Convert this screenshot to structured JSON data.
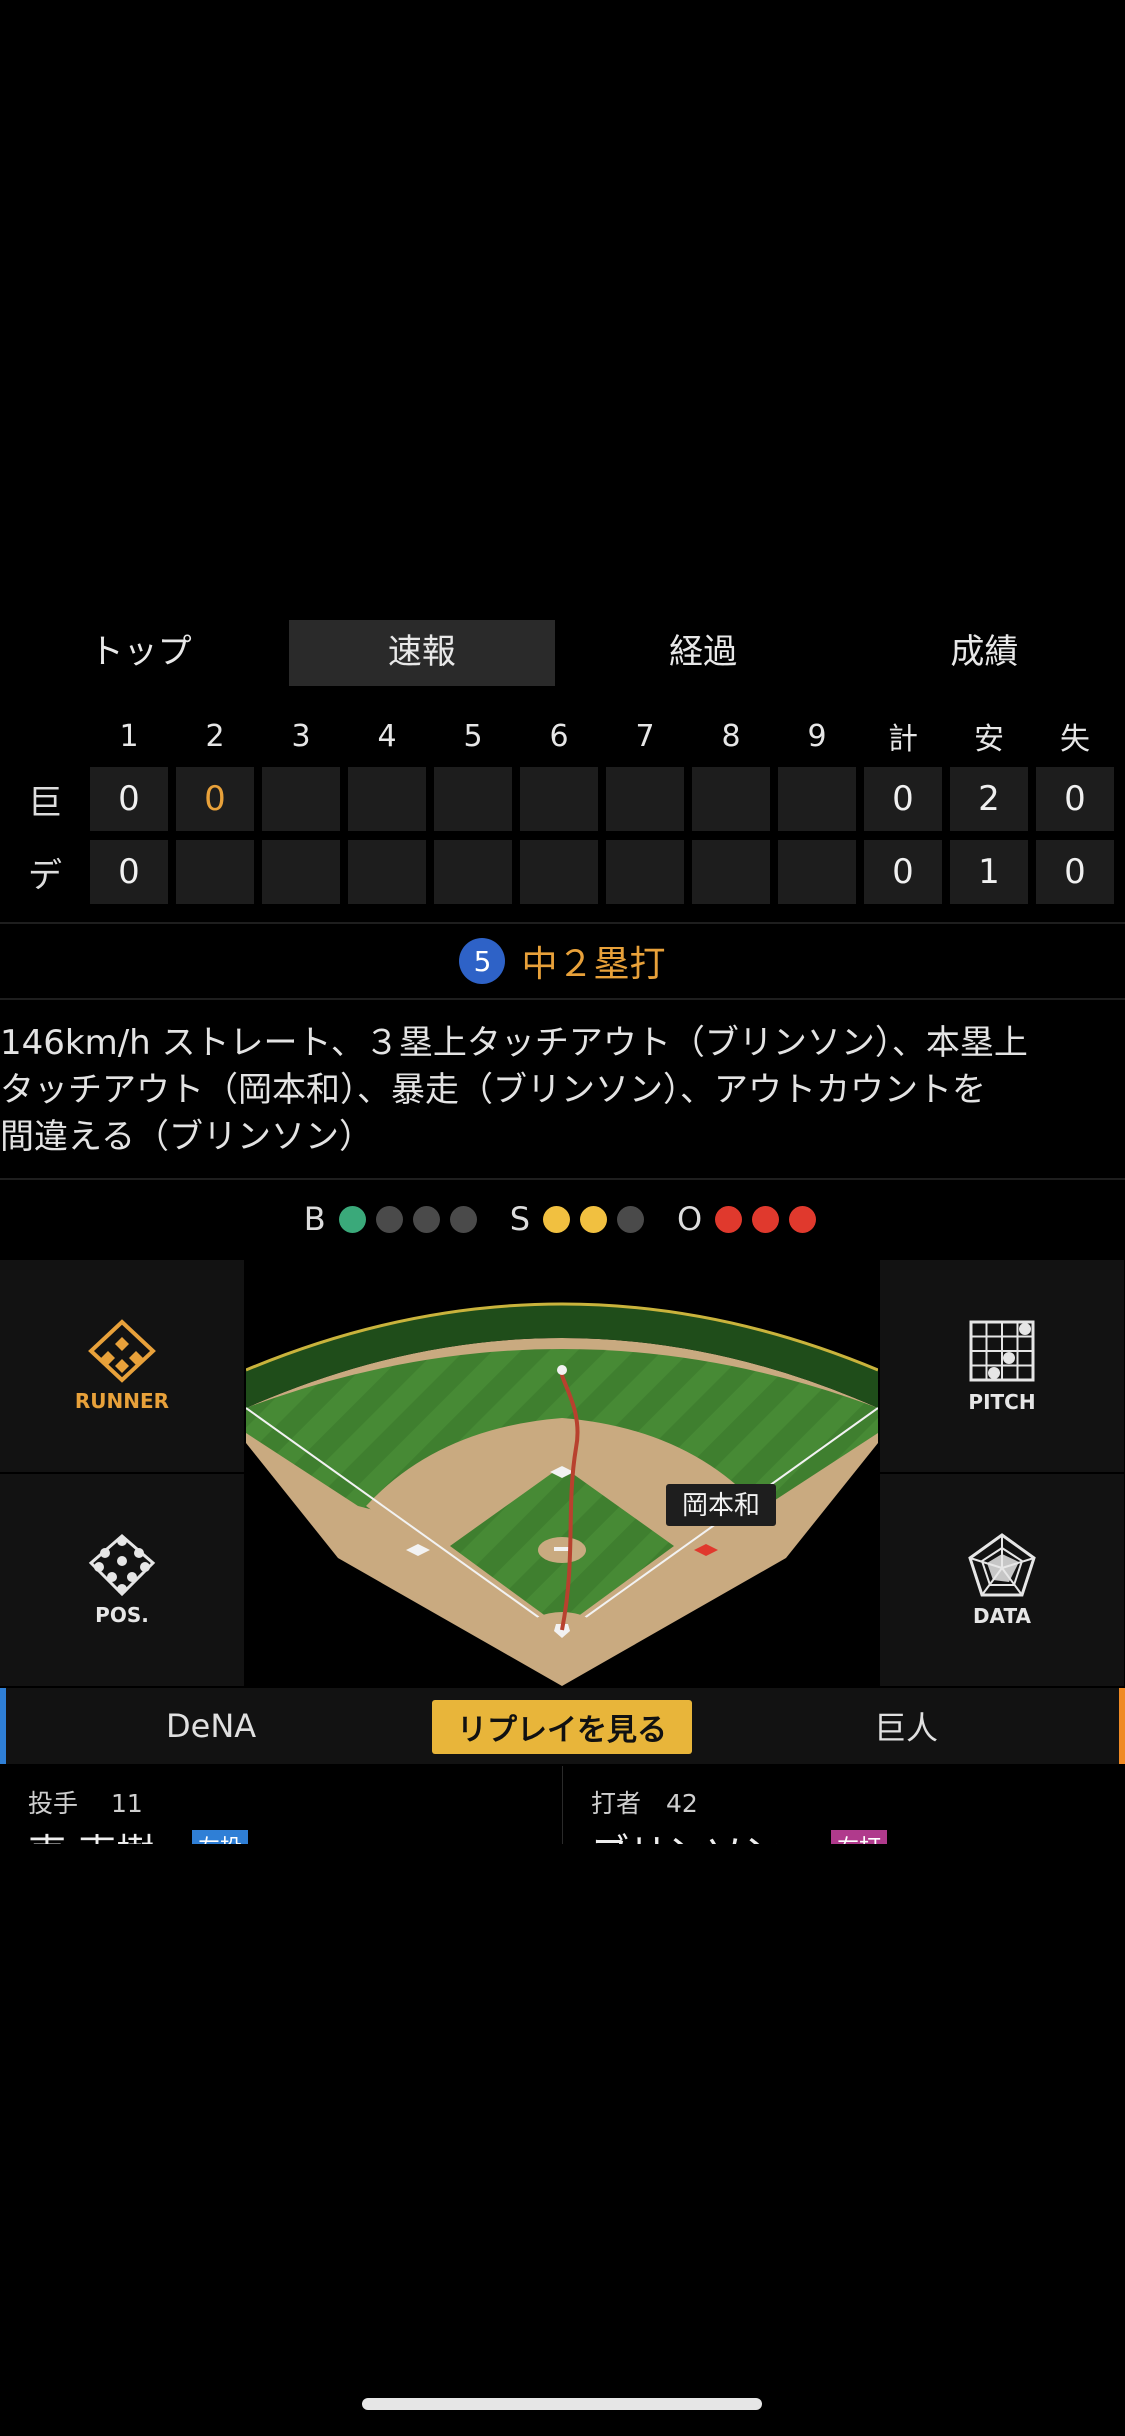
{
  "tabs": [
    "トップ",
    "速報",
    "経過",
    "成績"
  ],
  "scoreboard": {
    "headers": [
      "1",
      "2",
      "3",
      "4",
      "5",
      "6",
      "7",
      "8",
      "9",
      "計",
      "安",
      "失"
    ],
    "rows": [
      {
        "team": "巨",
        "cells": [
          "0",
          "0",
          "",
          "",
          "",
          "",
          "",
          "",
          "",
          "0",
          "2",
          "0"
        ]
      },
      {
        "team": "デ",
        "cells": [
          "0",
          "",
          "",
          "",
          "",
          "",
          "",
          "",
          "",
          "0",
          "1",
          "0"
        ]
      }
    ]
  },
  "play": {
    "number": "5",
    "text": "中２塁打"
  },
  "description": "146km/h ストレート、３塁上タッチアウト（ブリンソン）、本塁上\nタッチアウト（岡本和）、暴走（ブリンソン）、アウトカウントを\n間違える（ブリンソン）",
  "count": {
    "balls_label": "B",
    "strikes_label": "S",
    "outs_label": "O",
    "balls": 1,
    "strikes": 2,
    "outs": 3
  },
  "buttons": {
    "runner": "RUNNER",
    "pitch": "PITCH",
    "pos": "POS.",
    "data": "DATA"
  },
  "field": {
    "runner_label": "岡本和"
  },
  "replay": {
    "left_team": "DeNA",
    "button": "リプレイを見る",
    "right_team": "巨人"
  },
  "pitcher": {
    "role": "投手",
    "number": "11",
    "name": "東 克樹",
    "tag": "左投"
  },
  "batter": {
    "role": "打者",
    "number": "42",
    "name": "ブリンソン",
    "tag": "右打"
  },
  "colors": {
    "accent": "#e8a13a",
    "home_team": "#2f7fd6",
    "away_team": "#f08a24",
    "ball": "#3aa97a",
    "strike": "#f1c040",
    "out": "#e0392d"
  }
}
